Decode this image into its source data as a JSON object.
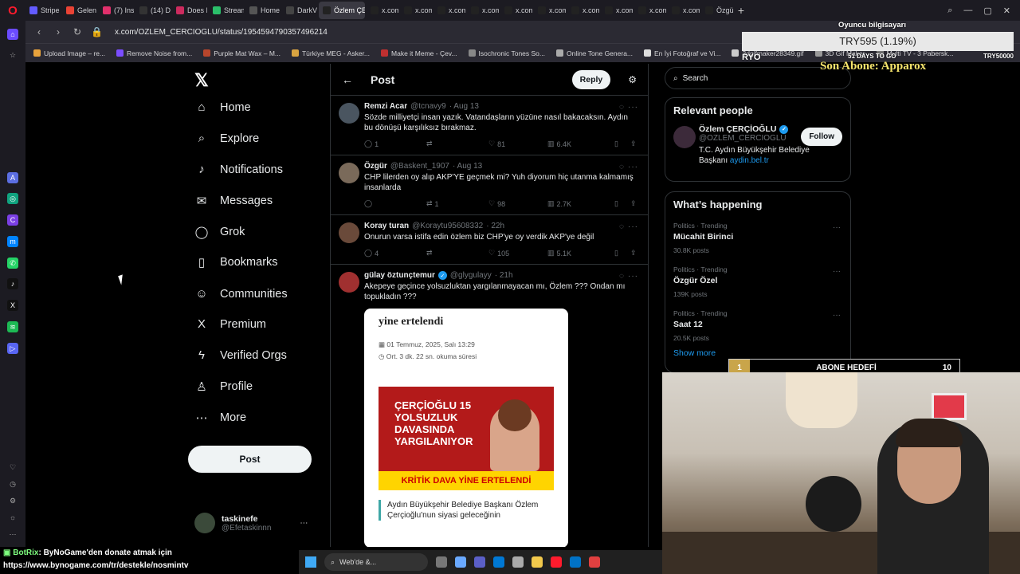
{
  "browser": {
    "tabs": [
      {
        "label": "Stripe",
        "color": "#635bff"
      },
      {
        "label": "Gelen",
        "color": "#ea4335"
      },
      {
        "label": "(7) Ins",
        "color": "#e1306c"
      },
      {
        "label": "(14) D",
        "color": "#333333"
      },
      {
        "label": "Does I",
        "color": "#cc2b5e"
      },
      {
        "label": "Stream",
        "color": "#2bbf6a"
      },
      {
        "label": "Home",
        "color": "#555555"
      },
      {
        "label": "DarkV",
        "color": "#444444"
      },
      {
        "label": "Özlem ÇERÇ",
        "color": "#222222",
        "active": true
      },
      {
        "label": "x.com",
        "color": "#222222"
      },
      {
        "label": "x.com",
        "color": "#222222"
      },
      {
        "label": "x.com",
        "color": "#222222"
      },
      {
        "label": "x.com",
        "color": "#222222"
      },
      {
        "label": "x.com",
        "color": "#222222"
      },
      {
        "label": "x.com",
        "color": "#222222"
      },
      {
        "label": "x.com",
        "color": "#222222"
      },
      {
        "label": "x.com",
        "color": "#222222"
      },
      {
        "label": "x.com",
        "color": "#222222"
      },
      {
        "label": "x.com",
        "color": "#222222"
      },
      {
        "label": "Özgür",
        "color": "#222222"
      }
    ],
    "url": "x.com/OZLEM_CERCIOGLU/status/1954594790357496214",
    "bookmarks": [
      {
        "label": "Upload Image – re...",
        "color": "#e8a33c"
      },
      {
        "label": "Remove Noise from...",
        "color": "#7b4dff"
      },
      {
        "label": "Purple Mat Wax – M...",
        "color": "#b8462c"
      },
      {
        "label": "Türkiye MEG - Asker...",
        "color": "#d9a441"
      },
      {
        "label": "Make it Meme - Çev...",
        "color": "#c03030"
      },
      {
        "label": "Isochronic Tones So...",
        "color": "#888888"
      },
      {
        "label": "Online Tone Genera...",
        "color": "#aaaaaa"
      },
      {
        "label": "En İyi Fotoğraf ve Vi...",
        "color": "#dddddd"
      },
      {
        "label": "3dgifmaker28349.gif",
        "color": "#cccccc"
      },
      {
        "label": "3D Gif Maker",
        "color": "#999999"
      },
      {
        "label": "Multi TV - 3 Pabersk...",
        "color": "#777777"
      }
    ]
  },
  "xnav": {
    "items": [
      {
        "label": "Home",
        "icon": "⌂"
      },
      {
        "label": "Explore",
        "icon": "⌕"
      },
      {
        "label": "Notifications",
        "icon": "♪"
      },
      {
        "label": "Messages",
        "icon": "✉"
      },
      {
        "label": "Grok",
        "icon": "◯"
      },
      {
        "label": "Bookmarks",
        "icon": "▯"
      },
      {
        "label": "Communities",
        "icon": "☺"
      },
      {
        "label": "Premium",
        "icon": "X"
      },
      {
        "label": "Verified Orgs",
        "icon": "ϟ"
      },
      {
        "label": "Profile",
        "icon": "♙"
      },
      {
        "label": "More",
        "icon": "⋯"
      }
    ],
    "post_label": "Post",
    "user_name": "taskinefe",
    "user_handle": "@Efetaskinnn"
  },
  "feed": {
    "title": "Post",
    "reply_label": "Reply",
    "tweets": [
      {
        "name": "Remzi Acar",
        "handle": "@tcnavy9",
        "time": "· Aug 13",
        "text": "Sözde milliyetçi insan yazık. Vatandaşların yüzüne nasıl bakacaksın. Aydın bu dönüşü karşılıksız bırakmaz.",
        "replies": "1",
        "reposts": "",
        "likes": "81",
        "views": "6.4K",
        "avatar_color": "#4a5560"
      },
      {
        "name": "Özgür",
        "handle": "@Baskent_1907",
        "time": "· Aug 13",
        "text": "CHP lilerden oy alıp AKP'YE geçmek mi? Yuh diyorum hiç utanma kalmamış insanlarda",
        "replies": "",
        "reposts": "1",
        "likes": "98",
        "views": "2.7K",
        "avatar_color": "#7a6a5a"
      },
      {
        "name": "Koray turan",
        "handle": "@Koraytu95608332",
        "time": "· 22h",
        "text": "Onurun varsa istifa edin özlem biz CHP'ye oy verdik AKP'ye değil",
        "replies": "4",
        "reposts": "",
        "likes": "105",
        "views": "5.1K",
        "avatar_color": "#6a4a3a"
      },
      {
        "name": "gülay öztunçtemur",
        "handle": "@glygulayy",
        "time": "· 21h",
        "text": "Akepeye geçince yolsuzluktan yargılanmayacan mı, Özlem ??? Ondan mı topukladın ???",
        "avatar_color": "#a03030"
      }
    ],
    "embed": {
      "headline": "yine ertelendi",
      "date": "01 Temmuz, 2025, Salı 13:29",
      "read_time": "Ort. 3 dk. 22 sn. okuma süresi",
      "image_headline": "ÇERÇİOĞLU 15 YOLSUZLUK DAVASINDA YARGILANIYOR",
      "image_banner": "KRİTİK DAVA YİNE ERTELENDİ",
      "quote": "Aydın Büyükşehir Belediye Başkanı Özlem Çerçioğlu'nun siyasi geleceğinin"
    }
  },
  "right": {
    "search_placeholder": "Search",
    "relevant_title": "Relevant people",
    "person": {
      "name": "Özlem ÇERÇİOĞLU",
      "handle": "@OZLEM_CERCIOGLU",
      "bio": "T.C. Aydın Büyükşehir Belediye Başkanı",
      "link": "aydin.bel.tr",
      "follow_label": "Follow"
    },
    "happening_title": "What’s happening",
    "trends": [
      {
        "category": "Politics · Trending",
        "name": "Mücahit Birinci",
        "posts": "30.8K posts"
      },
      {
        "category": "Politics · Trending",
        "name": "Özgür Özel",
        "posts": "139K posts"
      },
      {
        "category": "Politics · Trending",
        "name": "Saat 12",
        "posts": "20.5K posts"
      }
    ],
    "show_more": "Show more"
  },
  "overlay": {
    "oyuncu": "Oyuncu bilgisayarı",
    "price": "TRY595 (1.19%)",
    "ryo": "RYO",
    "days_to_go": "51 DAYS TO GO",
    "try_target": "TRY50000",
    "son_abone": "Son Abone: Apparox",
    "goal_current": "1",
    "goal_current_fraction": 0.1,
    "goal_label": "ABONE HEDEFİ",
    "goal_target": "10"
  },
  "chat": {
    "user": "BotRix",
    "message": ": ByNoGame'den donate atmak için",
    "link": "https://www.bynogame.com/tr/destekle/nosmintv"
  },
  "taskbar": {
    "search_label": "Web'de &..."
  }
}
